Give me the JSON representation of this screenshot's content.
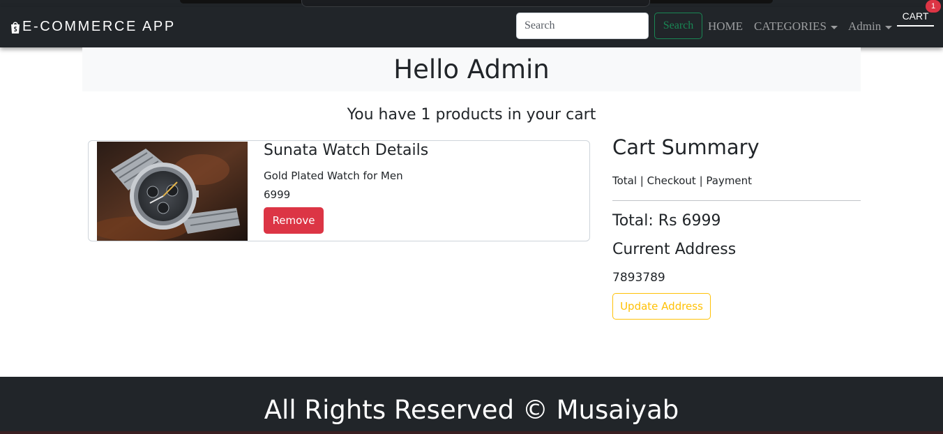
{
  "navbar": {
    "brand": "E-COMMERCE APP",
    "brand_icon": "shopify-bag-icon",
    "search_placeholder": "Search",
    "search_value": "",
    "search_button": "Search",
    "home": "HOME",
    "categories": "CATEGORIES",
    "user": "Admin",
    "cart": "CART",
    "cart_count": "1"
  },
  "header": {
    "greeting": "Hello Admin",
    "cart_message": "You have 1 products in your cart"
  },
  "cart_items": [
    {
      "name": "Sunata Watch Details",
      "description": "Gold Plated Watch for Men",
      "price": "6999",
      "remove_label": "Remove"
    }
  ],
  "summary": {
    "title": "Cart Summary",
    "subtitle": "Total | Checkout | Payment",
    "total": "Total: Rs 6999",
    "address_title": "Current Address",
    "address_value": "7893789",
    "update_button": "Update Address"
  },
  "footer": {
    "text": "All Rights Reserved © Musaiyab"
  },
  "colors": {
    "navbar_bg": "#212529",
    "success": "#198754",
    "danger": "#dc3545",
    "warning": "#ffc107"
  }
}
